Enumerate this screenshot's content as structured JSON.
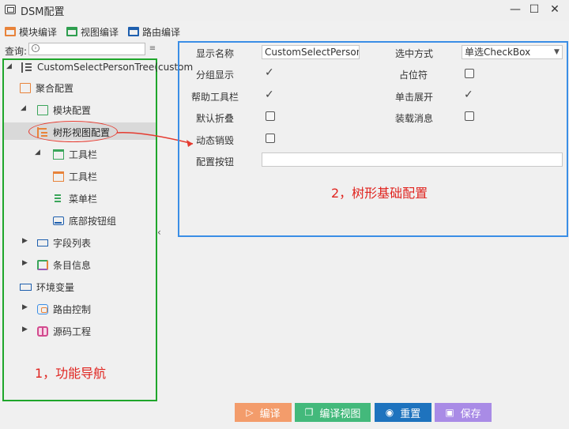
{
  "window": {
    "title": "DSM配置",
    "minimize": "—",
    "maximize": "☐",
    "close": "✕"
  },
  "toolbar": {
    "module_compile": "模块编译",
    "view_compile": "视图编译",
    "route_compile": "路由编译"
  },
  "search": {
    "label": "查询:",
    "placeholder": ""
  },
  "tree": {
    "root": "CustomSelectPersonTree(custom",
    "aggregate": "聚合配置",
    "module_config": "模块配置",
    "tree_view_config": "树形视图配置",
    "toolbar_group": "工具栏",
    "toolbar": "工具栏",
    "menubar": "菜单栏",
    "bottom_buttons": "底部按钮组",
    "field_list": "字段列表",
    "item_info": "条目信息",
    "env_vars": "环境变量",
    "route_control": "路由控制",
    "source_project": "源码工程"
  },
  "annotations": {
    "nav": "1，功能导航",
    "config": "2，树形基础配置"
  },
  "config": {
    "display_name_label": "显示名称",
    "display_name_value": "CustomSelectPersonTree",
    "selection_mode_label": "选中方式",
    "selection_mode_value": "单选CheckBox",
    "group_display_label": "分组显示",
    "group_display_checked": true,
    "placeholder_label": "占位符",
    "placeholder_checked": false,
    "help_toolbar_label": "帮助工具栏",
    "help_toolbar_checked": true,
    "single_click_expand_label": "单击展开",
    "single_click_expand_checked": true,
    "default_collapse_label": "默认折叠",
    "default_collapse_checked": false,
    "load_message_label": "装载消息",
    "load_message_checked": false,
    "dynamic_destroy_label": "动态销毁",
    "dynamic_destroy_checked": false,
    "config_buttons_label": "配置按钮",
    "config_buttons_value": ""
  },
  "buttons": {
    "compile": "编译",
    "compile_view": "编译视图",
    "reset": "重置",
    "save": "保存"
  },
  "colors": {
    "compile": "#f39c6b",
    "compile_view": "#43b97b",
    "reset": "#1e73be",
    "save": "#a98be6",
    "nav_border": "#1fa62b",
    "config_border": "#3a8ee6",
    "annotation": "#e0241f"
  },
  "icons": {
    "window": "window-icon",
    "search": "search-icon",
    "check": "checkmark-icon"
  }
}
